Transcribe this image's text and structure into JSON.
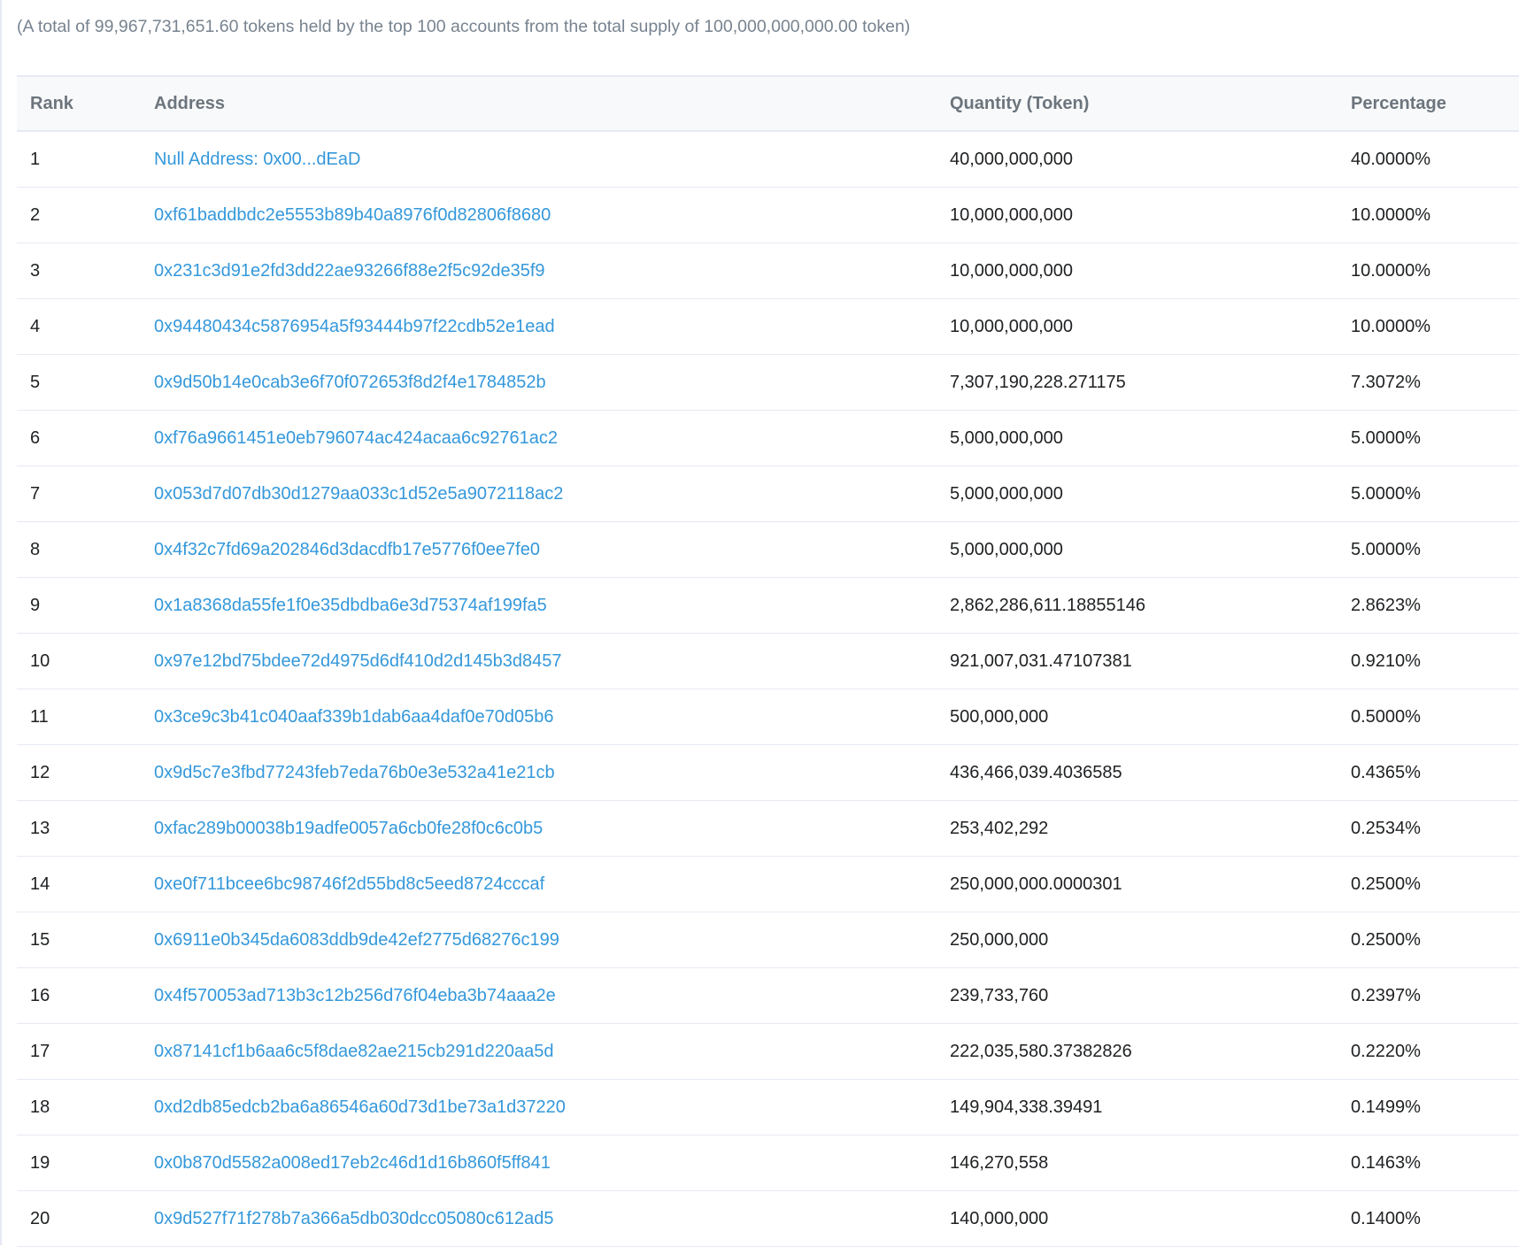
{
  "summary": "(A total of 99,967,731,651.60 tokens held by the top 100 accounts from the total supply of 100,000,000,000.00 token)",
  "table": {
    "headers": {
      "rank": "Rank",
      "address": "Address",
      "quantity": "Quantity (Token)",
      "percentage": "Percentage"
    },
    "rows": [
      {
        "rank": "1",
        "address": "Null Address: 0x00...dEaD",
        "quantity": "40,000,000,000",
        "percentage": "40.0000%"
      },
      {
        "rank": "2",
        "address": "0xf61baddbdc2e5553b89b40a8976f0d82806f8680",
        "quantity": "10,000,000,000",
        "percentage": "10.0000%"
      },
      {
        "rank": "3",
        "address": "0x231c3d91e2fd3dd22ae93266f88e2f5c92de35f9",
        "quantity": "10,000,000,000",
        "percentage": "10.0000%"
      },
      {
        "rank": "4",
        "address": "0x94480434c5876954a5f93444b97f22cdb52e1ead",
        "quantity": "10,000,000,000",
        "percentage": "10.0000%"
      },
      {
        "rank": "5",
        "address": "0x9d50b14e0cab3e6f70f072653f8d2f4e1784852b",
        "quantity": "7,307,190,228.271175",
        "percentage": "7.3072%"
      },
      {
        "rank": "6",
        "address": "0xf76a9661451e0eb796074ac424acaa6c92761ac2",
        "quantity": "5,000,000,000",
        "percentage": "5.0000%"
      },
      {
        "rank": "7",
        "address": "0x053d7d07db30d1279aa033c1d52e5a9072118ac2",
        "quantity": "5,000,000,000",
        "percentage": "5.0000%"
      },
      {
        "rank": "8",
        "address": "0x4f32c7fd69a202846d3dacdfb17e5776f0ee7fe0",
        "quantity": "5,000,000,000",
        "percentage": "5.0000%"
      },
      {
        "rank": "9",
        "address": "0x1a8368da55fe1f0e35dbdba6e3d75374af199fa5",
        "quantity": "2,862,286,611.18855146",
        "percentage": "2.8623%"
      },
      {
        "rank": "10",
        "address": "0x97e12bd75bdee72d4975d6df410d2d145b3d8457",
        "quantity": "921,007,031.47107381",
        "percentage": "0.9210%"
      },
      {
        "rank": "11",
        "address": "0x3ce9c3b41c040aaf339b1dab6aa4daf0e70d05b6",
        "quantity": "500,000,000",
        "percentage": "0.5000%"
      },
      {
        "rank": "12",
        "address": "0x9d5c7e3fbd77243feb7eda76b0e3e532a41e21cb",
        "quantity": "436,466,039.4036585",
        "percentage": "0.4365%"
      },
      {
        "rank": "13",
        "address": "0xfac289b00038b19adfe0057a6cb0fe28f0c6c0b5",
        "quantity": "253,402,292",
        "percentage": "0.2534%"
      },
      {
        "rank": "14",
        "address": "0xe0f711bcee6bc98746f2d55bd8c5eed8724cccaf",
        "quantity": "250,000,000.0000301",
        "percentage": "0.2500%"
      },
      {
        "rank": "15",
        "address": "0x6911e0b345da6083ddb9de42ef2775d68276c199",
        "quantity": "250,000,000",
        "percentage": "0.2500%"
      },
      {
        "rank": "16",
        "address": "0x4f570053ad713b3c12b256d76f04eba3b74aaa2e",
        "quantity": "239,733,760",
        "percentage": "0.2397%"
      },
      {
        "rank": "17",
        "address": "0x87141cf1b6aa6c5f8dae82ae215cb291d220aa5d",
        "quantity": "222,035,580.37382826",
        "percentage": "0.2220%"
      },
      {
        "rank": "18",
        "address": "0xd2db85edcb2ba6a86546a60d73d1be73a1d37220",
        "quantity": "149,904,338.39491",
        "percentage": "0.1499%"
      },
      {
        "rank": "19",
        "address": "0x0b870d5582a008ed17eb2c46d1d16b860f5ff841",
        "quantity": "146,270,558",
        "percentage": "0.1463%"
      },
      {
        "rank": "20",
        "address": "0x9d527f71f278b7a366a5db030dcc05080c612ad5",
        "quantity": "140,000,000",
        "percentage": "0.1400%"
      }
    ]
  },
  "colors": {
    "link": "#3498db",
    "text": "#1e2022",
    "muted": "#77838f",
    "header_bg": "#f8f9fa",
    "border": "#e7eaf3"
  }
}
